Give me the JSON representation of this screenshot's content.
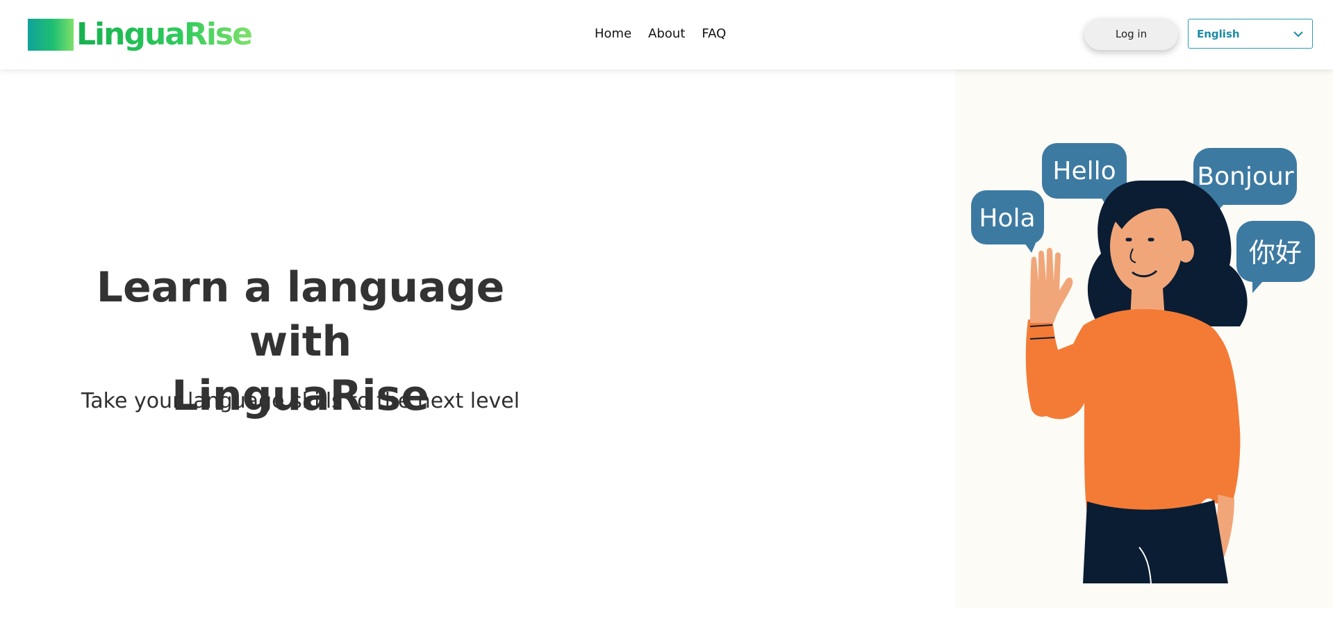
{
  "brand": {
    "name": "LinguaRise",
    "colors": {
      "gradient_start": "#0fa39a",
      "gradient_end": "#7ee06a"
    }
  },
  "nav": {
    "items": [
      {
        "label": "Home"
      },
      {
        "label": "About"
      },
      {
        "label": "FAQ"
      }
    ]
  },
  "header": {
    "login_label": "Log in",
    "language_select": {
      "selected": "English"
    }
  },
  "hero": {
    "title_line1": "Learn a language with",
    "title_line2": "LinguaRise",
    "subtitle": "Take your language skills to the next level"
  },
  "illustration": {
    "bubbles": [
      {
        "text": "Hello"
      },
      {
        "text": "Hola"
      },
      {
        "text": "Bonjour"
      },
      {
        "text": "你好"
      }
    ],
    "colors": {
      "bubble": "#3d7aa2",
      "shirt": "#f47b36",
      "hair": "#0b1d33",
      "skin": "#f1a679",
      "pants": "#0b1d33"
    }
  }
}
